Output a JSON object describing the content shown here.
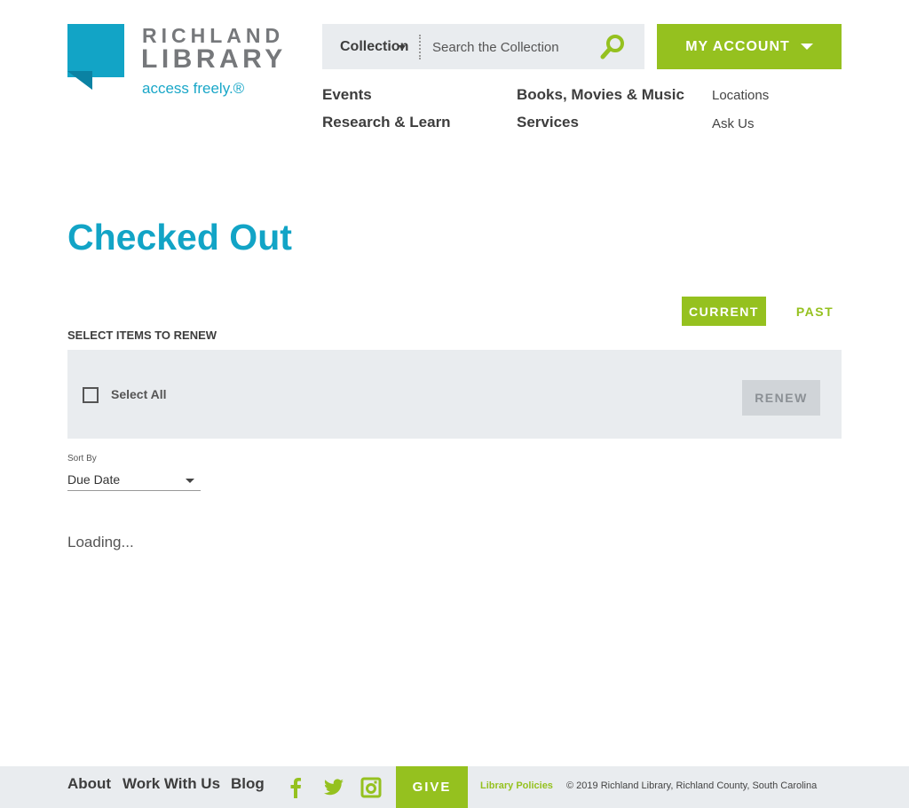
{
  "brand": {
    "name_line1": "RICHLAND",
    "name_line2": "LIBRARY",
    "tagline": "access freely.®"
  },
  "search": {
    "scope": "Collection",
    "placeholder": "Search the Collection"
  },
  "account": {
    "label": "MY ACCOUNT"
  },
  "nav": {
    "events": "Events",
    "research": "Research & Learn",
    "books": "Books, Movies & Music",
    "services": "Services",
    "locations": "Locations",
    "ask": "Ask Us"
  },
  "main": {
    "title": "Checked Out",
    "tabs": {
      "current": "CURRENT",
      "past": "PAST"
    },
    "section_label": "SELECT ITEMS TO RENEW",
    "select_all": "Select All",
    "renew": "RENEW",
    "sort_label": "Sort By",
    "sort_value": "Due Date",
    "loading": "Loading..."
  },
  "footer": {
    "about": "About",
    "work": "Work With Us",
    "blog": "Blog",
    "give": "GIVE",
    "policies": "Library Policies",
    "copyright": "© 2019 Richland Library, Richland County, South Carolina"
  },
  "colors": {
    "brand_blue": "#12a4c6",
    "accent_green": "#95c11f",
    "panel_gray": "#e9ecef"
  },
  "icons": [
    "logo-mark-icon",
    "search-icon",
    "chevron-down-icon",
    "facebook-icon",
    "twitter-icon",
    "instagram-icon"
  ]
}
